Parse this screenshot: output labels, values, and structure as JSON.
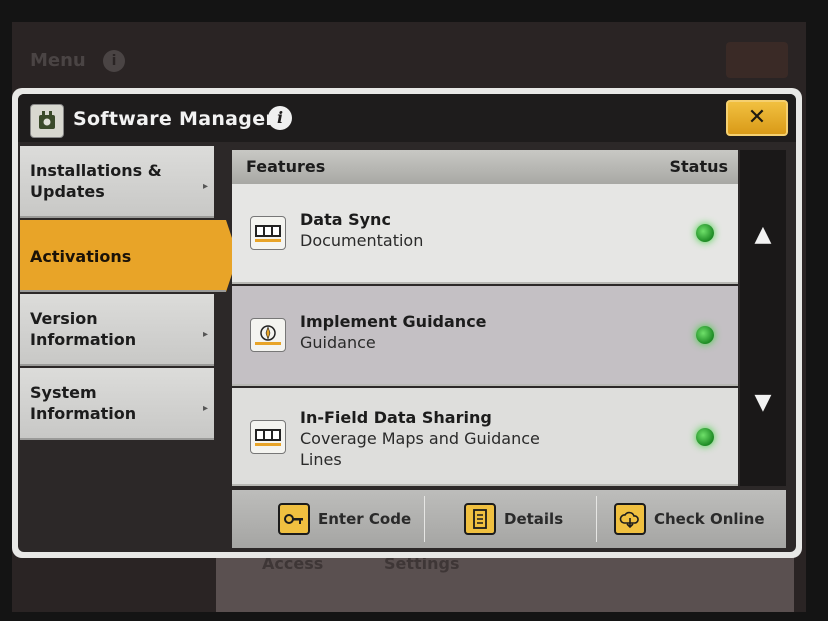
{
  "background": {
    "title": "Menu",
    "info_glyph": "i",
    "bottom_left_text": "Access",
    "bottom_right_text": "Settings"
  },
  "dialog": {
    "title": "Software Manager",
    "info_glyph": "i",
    "close_glyph": "✕",
    "app_icon": "software-manager-icon"
  },
  "nav": {
    "items": [
      {
        "label": "Installations & Updates",
        "active": false
      },
      {
        "label": "Activations",
        "active": true
      },
      {
        "label": "Version Information",
        "active": false
      },
      {
        "label": "System Information",
        "active": false
      }
    ],
    "chevron_glyph": "▸"
  },
  "list": {
    "header_features": "Features",
    "header_status": "Status",
    "rows": [
      {
        "name": "Data Sync",
        "category": "Documentation",
        "icon": "counter-icon",
        "status": "active",
        "status_color": "#3bd03a"
      },
      {
        "name": "Implement Guidance",
        "category": "Guidance",
        "icon": "compass-icon",
        "status": "active",
        "status_color": "#3bd03a"
      },
      {
        "name": "In-Field Data Sharing",
        "category": "Coverage Maps and Guidance Lines",
        "icon": "counter-icon",
        "status": "active",
        "status_color": "#3bd03a"
      }
    ]
  },
  "scroll": {
    "up_glyph": "▲",
    "down_glyph": "▼"
  },
  "buttons": {
    "enter_code": "Enter Code",
    "details": "Details",
    "check_online": "Check Online"
  },
  "colors": {
    "accent": "#e8a428",
    "status_on": "#3bd03a"
  }
}
